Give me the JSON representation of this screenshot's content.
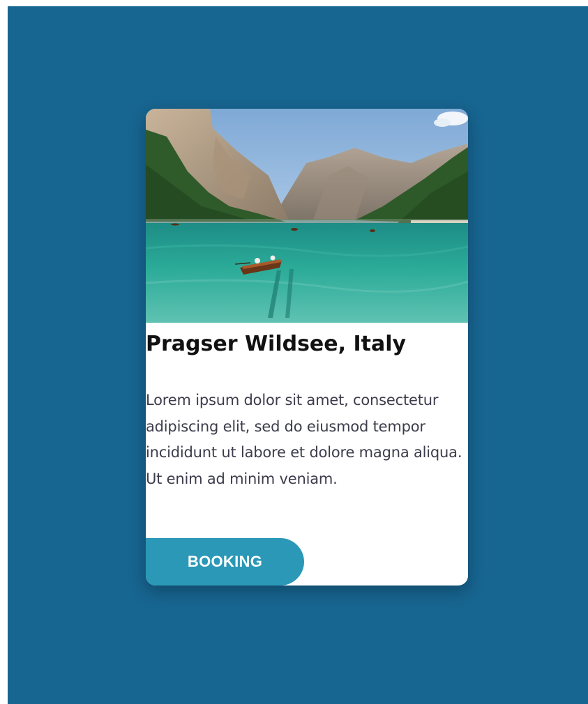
{
  "card": {
    "image_alt": "Lake with mountains and a rowing boat",
    "title": "Pragser Wildsee, Italy",
    "description": "Lorem ipsum dolor sit amet, consectetur adipiscing elit, sed do eiusmod tempor incididunt ut labore et dolore magna aliqua. Ut enim ad minim veniam.",
    "button_label": "BOOKING"
  },
  "colors": {
    "page_background": "#176591",
    "card_background": "#ffffff",
    "button": "#2a98b6",
    "title": "#111111",
    "description": "#3c3c4c"
  }
}
